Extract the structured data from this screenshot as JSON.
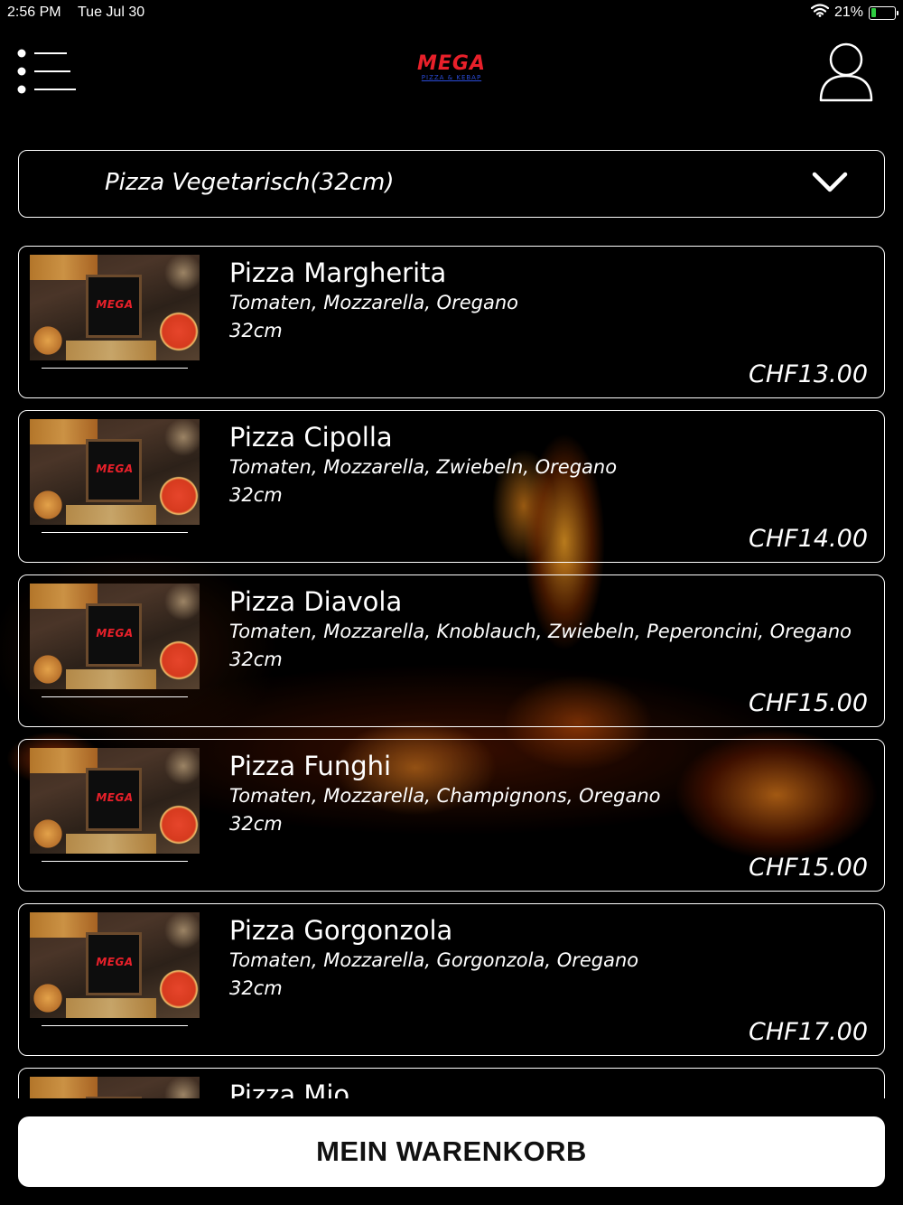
{
  "status_bar": {
    "time": "2:56 PM",
    "date": "Tue Jul 30",
    "battery_percent": "21%",
    "battery_level": 0.21,
    "icons": [
      "wifi-icon",
      "battery-charging-icon"
    ]
  },
  "header": {
    "logo_main": "MEGA",
    "logo_sub": "PIZZA & KEBAP",
    "icons": [
      "menu-list-icon",
      "user-profile-icon"
    ]
  },
  "category": {
    "selected": "Pizza Vegetarisch(32cm)",
    "icon": "chevron-down-icon"
  },
  "items": [
    {
      "name": "Pizza Margherita",
      "desc": "Tomaten, Mozzarella, Oregano",
      "size": "32cm",
      "price": "CHF13.00"
    },
    {
      "name": "Pizza Cipolla",
      "desc": "Tomaten, Mozzarella, Zwiebeln, Oregano",
      "size": "32cm",
      "price": "CHF14.00"
    },
    {
      "name": "Pizza Diavola",
      "desc": "Tomaten, Mozzarella, Knoblauch, Zwiebeln, Peperoncini, Oregano",
      "size": "32cm",
      "price": "CHF15.00"
    },
    {
      "name": "Pizza Funghi",
      "desc": "Tomaten, Mozzarella, Champignons, Oregano",
      "size": "32cm",
      "price": "CHF15.00"
    },
    {
      "name": "Pizza Gorgonzola",
      "desc": "Tomaten, Mozzarella, Gorgonzola, Oregano",
      "size": "32cm",
      "price": "CHF17.00"
    },
    {
      "name": "Pizza Mio",
      "desc": "",
      "size": "",
      "price": ""
    }
  ],
  "thumb_logo": "MEGA",
  "cart": {
    "label": "MEIN WARENKORB"
  },
  "colors": {
    "background": "#000000",
    "logo_red": "#e8202a",
    "logo_blue": "#2a4bd8",
    "battery_green": "#2ecc40",
    "cart_button_bg": "#ffffff"
  }
}
